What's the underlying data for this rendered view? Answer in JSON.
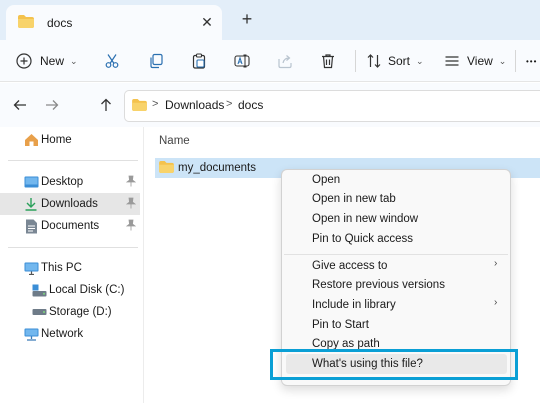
{
  "tab": {
    "title": "docs",
    "close_symbol": "✕",
    "new_tab_symbol": "+"
  },
  "toolbar": {
    "new_label": "New",
    "sort_label": "Sort",
    "view_label": "View",
    "more_symbol": "•••",
    "chevron_symbol": "⌄"
  },
  "address": {
    "crumbs": [
      "Downloads",
      "docs"
    ],
    "separator": ">"
  },
  "sidebar": {
    "items": [
      {
        "label": "Home"
      },
      {
        "label": "Desktop"
      },
      {
        "label": "Downloads"
      },
      {
        "label": "Documents"
      },
      {
        "label": "This PC"
      },
      {
        "label": "Local Disk (C:)"
      },
      {
        "label": "Storage (D:)"
      },
      {
        "label": "Network"
      }
    ]
  },
  "main": {
    "column_header": "Name",
    "rows": [
      {
        "name": "my_documents"
      }
    ]
  },
  "context_menu": {
    "items": [
      {
        "label": "Open"
      },
      {
        "label": "Open in new tab"
      },
      {
        "label": "Open in new window"
      },
      {
        "label": "Pin to Quick access"
      },
      {
        "label": "Give access to",
        "submenu": true
      },
      {
        "label": "Restore previous versions"
      },
      {
        "label": "Include in library",
        "submenu": true
      },
      {
        "label": "Pin to Start"
      },
      {
        "label": "Copy as path"
      },
      {
        "label": "What's using this file?"
      }
    ],
    "submenu_arrow": "›"
  },
  "colors": {
    "accent_highlight": "#0a9fd5",
    "selection": "#cce4f7",
    "titlebar": "#e3eef9",
    "folder_yellow": "#f4c24d"
  },
  "icons": {
    "tab": "folder-icon",
    "toolbar": [
      "new-plus-icon",
      "cut-icon",
      "copy-icon",
      "paste-icon",
      "rename-icon",
      "share-icon",
      "delete-icon",
      "sort-icon",
      "view-icon"
    ],
    "nav": [
      "back-arrow-icon",
      "forward-arrow-icon",
      "up-arrow-icon"
    ],
    "sidebar": [
      "home-icon",
      "desktop-icon",
      "download-icon",
      "documents-icon",
      "this-pc-icon",
      "local-disk-icon",
      "storage-drive-icon",
      "network-icon"
    ],
    "pin": "pin-icon"
  }
}
